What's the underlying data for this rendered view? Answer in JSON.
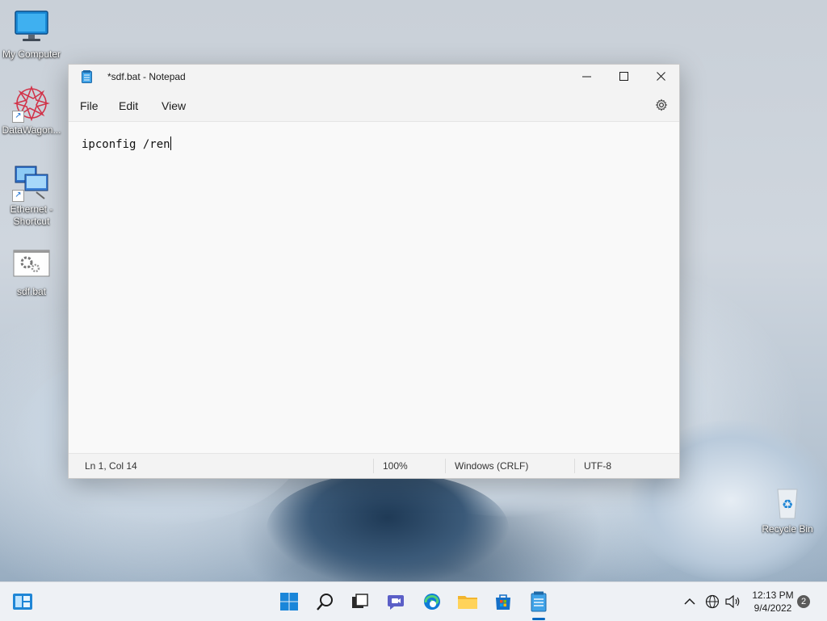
{
  "desktop": {
    "icons": [
      {
        "label": "My Computer"
      },
      {
        "label": "DataWagon..."
      },
      {
        "label": "Ethernet -\nShortcut"
      },
      {
        "label": "sdf.bat"
      },
      {
        "label": "Recycle Bin"
      }
    ]
  },
  "notepad": {
    "title": "*sdf.bat - Notepad",
    "menu": {
      "file": "File",
      "edit": "Edit",
      "view": "View"
    },
    "content": "ipconfig /ren",
    "status": {
      "position": "Ln 1, Col 14",
      "zoom": "100%",
      "line_ending": "Windows (CRLF)",
      "encoding": "UTF-8"
    },
    "caption": {
      "minimize": "—",
      "maximize": "☐",
      "close": "✕"
    }
  },
  "taskbar": {
    "clock_time": "12:13 PM",
    "clock_date": "9/4/2022",
    "notification_count": "2",
    "accent": "#0067c0"
  }
}
